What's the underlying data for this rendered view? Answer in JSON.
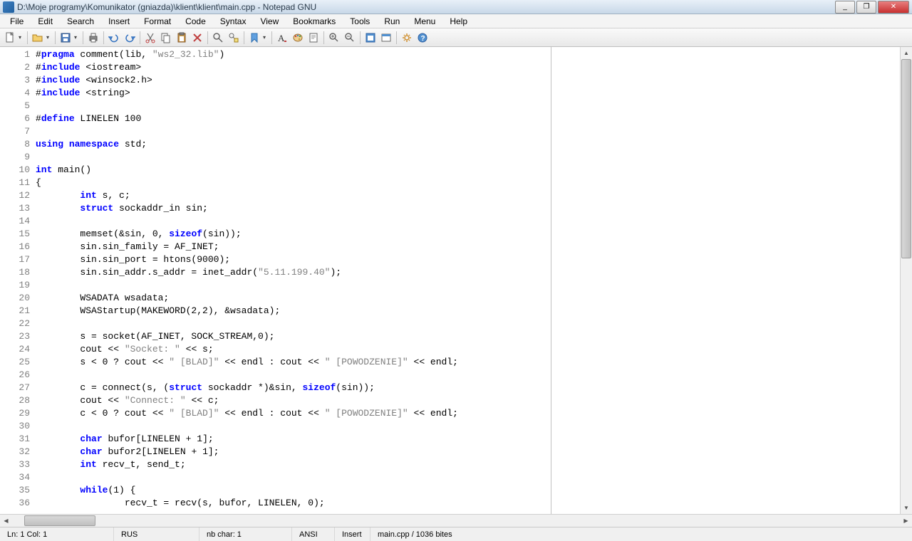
{
  "title": "D:\\Moje programy\\Komunikator (gniazda)\\klient\\klient\\main.cpp - Notepad GNU",
  "menu": {
    "file": "File",
    "edit": "Edit",
    "search": "Search",
    "insert": "Insert",
    "format": "Format",
    "code": "Code",
    "syntax": "Syntax",
    "view": "View",
    "bookmarks": "Bookmarks",
    "tools": "Tools",
    "run": "Run",
    "menu": "Menu",
    "help": "Help"
  },
  "win": {
    "min": "_",
    "max": "❐",
    "close": "✕"
  },
  "code_lines": [
    {
      "n": 1,
      "html": "#<span class='kw'>pragma</span> comment(lib, <span class='str'>\"ws2_32.lib\"</span>)"
    },
    {
      "n": 2,
      "html": "#<span class='kw'>include</span> &lt;iostream&gt;"
    },
    {
      "n": 3,
      "html": "#<span class='kw'>include</span> &lt;winsock2.h&gt;"
    },
    {
      "n": 4,
      "html": "#<span class='kw'>include</span> &lt;string&gt;"
    },
    {
      "n": 5,
      "html": ""
    },
    {
      "n": 6,
      "html": "#<span class='kw'>define</span> LINELEN 100"
    },
    {
      "n": 7,
      "html": ""
    },
    {
      "n": 8,
      "html": "<span class='kw'>using</span> <span class='kw'>namespace</span> std;"
    },
    {
      "n": 9,
      "html": ""
    },
    {
      "n": 10,
      "html": "<span class='kw'>int</span> main()"
    },
    {
      "n": 11,
      "html": "{"
    },
    {
      "n": 12,
      "html": "        <span class='kw'>int</span> s, c;"
    },
    {
      "n": 13,
      "html": "        <span class='kw'>struct</span> sockaddr_in sin;"
    },
    {
      "n": 14,
      "html": ""
    },
    {
      "n": 15,
      "html": "        memset(&amp;sin, 0, <span class='kw'>sizeof</span>(sin));"
    },
    {
      "n": 16,
      "html": "        sin.sin_family = AF_INET;"
    },
    {
      "n": 17,
      "html": "        sin.sin_port = htons(9000);"
    },
    {
      "n": 18,
      "html": "        sin.sin_addr.s_addr = inet_addr(<span class='str'>\"5.11.199.40\"</span>);"
    },
    {
      "n": 19,
      "html": ""
    },
    {
      "n": 20,
      "html": "        WSADATA wsadata;"
    },
    {
      "n": 21,
      "html": "        WSAStartup(MAKEWORD(2,2), &amp;wsadata);"
    },
    {
      "n": 22,
      "html": ""
    },
    {
      "n": 23,
      "html": "        s = socket(AF_INET, SOCK_STREAM,0);"
    },
    {
      "n": 24,
      "html": "        cout &lt;&lt; <span class='str'>\"Socket: \"</span> &lt;&lt; s;"
    },
    {
      "n": 25,
      "html": "        s &lt; 0 ? cout &lt;&lt; <span class='str'>\" [BLAD]\"</span> &lt;&lt; endl : cout &lt;&lt; <span class='str'>\" [POWODZENIE]\"</span> &lt;&lt; endl;"
    },
    {
      "n": 26,
      "html": ""
    },
    {
      "n": 27,
      "html": "        c = connect(s, (<span class='kw'>struct</span> sockaddr *)&amp;sin, <span class='kw'>sizeof</span>(sin));"
    },
    {
      "n": 28,
      "html": "        cout &lt;&lt; <span class='str'>\"Connect: \"</span> &lt;&lt; c;"
    },
    {
      "n": 29,
      "html": "        c &lt; 0 ? cout &lt;&lt; <span class='str'>\" [BLAD]\"</span> &lt;&lt; endl : cout &lt;&lt; <span class='str'>\" [POWODZENIE]\"</span> &lt;&lt; endl;"
    },
    {
      "n": 30,
      "html": ""
    },
    {
      "n": 31,
      "html": "        <span class='kw'>char</span> bufor[LINELEN + 1];"
    },
    {
      "n": 32,
      "html": "        <span class='kw'>char</span> bufor2[LINELEN + 1];"
    },
    {
      "n": 33,
      "html": "        <span class='kw'>int</span> recv_t, send_t;"
    },
    {
      "n": 34,
      "html": ""
    },
    {
      "n": 35,
      "html": "        <span class='kw'>while</span>(1) {"
    },
    {
      "n": 36,
      "html": "                recv_t = recv(s, bufor, LINELEN, 0);"
    }
  ],
  "status": {
    "pos": "Ln: 1 Col: 1",
    "lang": "RUS",
    "nbchar": "nb char: 1",
    "enc": "ANSI",
    "ins": "Insert",
    "file": "main.cpp / 1036 bites"
  }
}
